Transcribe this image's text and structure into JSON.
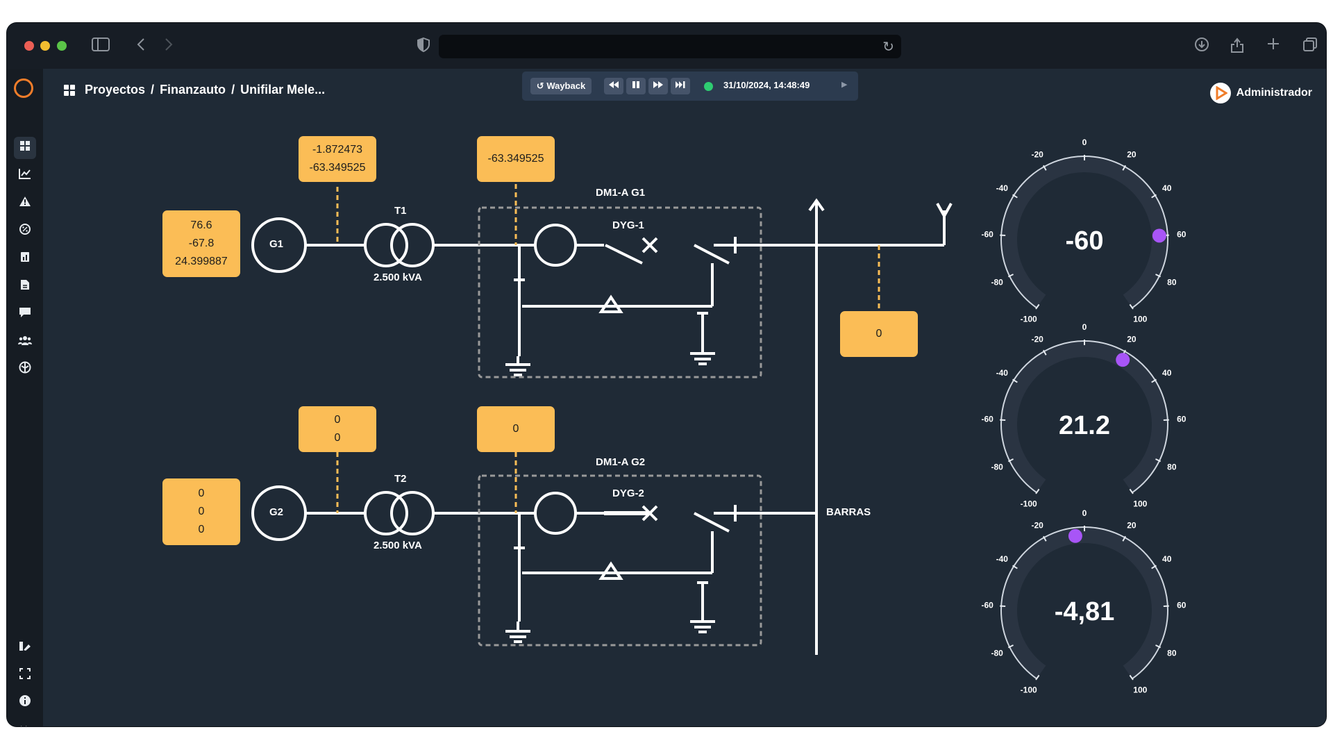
{
  "browser": {
    "url": ""
  },
  "breadcrumb": {
    "root": "Proyectos",
    "sep1": "/",
    "project": "Finanzauto",
    "sep2": "/",
    "page": "Unifilar Mele..."
  },
  "wayback": {
    "label": "Wayback",
    "timestamp": "31/10/2024, 14:48:49",
    "status_color": "#2ecc71"
  },
  "user": {
    "name": "Administrador"
  },
  "sidebar": {
    "items": [
      "dashboard-icon",
      "chart-icon",
      "alert-icon",
      "percent-icon",
      "report-icon",
      "document-icon",
      "message-icon",
      "users-icon",
      "network-icon"
    ],
    "bottom": [
      "palette-icon",
      "fullscreen-icon",
      "info-icon",
      "expand-icon"
    ]
  },
  "diagram": {
    "g1_box": [
      "76.6",
      "-67.8",
      "24.399887"
    ],
    "g1_top_box": [
      "-1.872473",
      "-63.349525"
    ],
    "dm1_top_box": [
      "-63.349525"
    ],
    "bus_box": [
      "0"
    ],
    "g2_box": [
      "0",
      "0",
      "0"
    ],
    "g2_top_box": [
      "0",
      "0"
    ],
    "dm2_top_box": [
      "0"
    ],
    "g1_label": "G1",
    "g2_label": "G2",
    "t1_label": "T1",
    "t2_label": "T2",
    "t1_rating": "2.500 kVA",
    "t2_rating": "2.500 kVA",
    "dm1_label": "DM1-A G1",
    "dm2_label": "DM1-A G2",
    "dyg1_label": "DYG-1",
    "dyg2_label": "DYG-2",
    "bus_label": "BARRAS"
  },
  "gauges": [
    {
      "value": 60.0,
      "display": "-60",
      "ticks": [
        "-100",
        "-80",
        "-60",
        "-40",
        "-20",
        "0",
        "20",
        "40",
        "60",
        "80",
        "100"
      ]
    },
    {
      "value": 21.2,
      "display": "21.2",
      "ticks": [
        "-100",
        "-80",
        "-60",
        "-40",
        "-20",
        "0",
        "20",
        "40",
        "60",
        "80",
        "100"
      ]
    },
    {
      "value": -4.81,
      "display": "-4,81",
      "ticks": [
        "-100",
        "-80",
        "-60",
        "-40",
        "-20",
        "0",
        "20",
        "40",
        "60",
        "80",
        "100"
      ]
    }
  ],
  "colors": {
    "accent": "#fbbd56",
    "gauge_marker": "#a855f7",
    "background": "#1f2a36"
  }
}
